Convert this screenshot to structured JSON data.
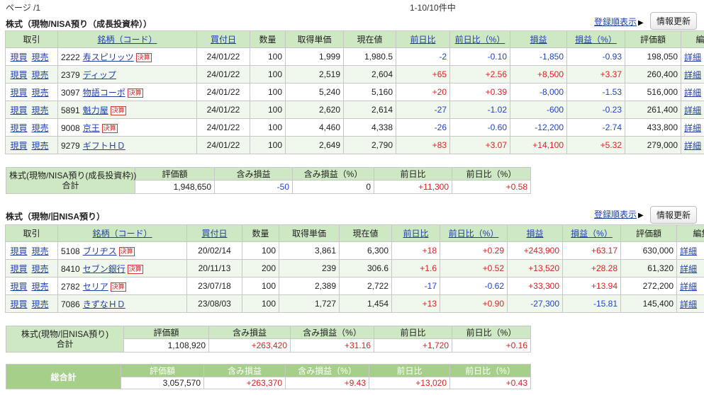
{
  "page_label": "ページ /1",
  "count_label": "1-10/10件中",
  "order_link": "登録順表示",
  "refresh_label": "情報更新",
  "headers": [
    "取引",
    "銘柄（コード）",
    "買付日",
    "数量",
    "取得単価",
    "現在値",
    "前日比",
    "前日比（%）",
    "損益",
    "損益（%）",
    "評価額",
    "編集"
  ],
  "detail_label": "詳細",
  "buy_label": "現買",
  "sell_label": "現売",
  "kessan_label": "決算",
  "sections": [
    {
      "title": "株式（現物/NISA預り（成長投資枠））",
      "rows": [
        {
          "code": "2222",
          "name": "寿スピリッツ",
          "kessan": true,
          "date": "24/01/22",
          "qty": "100",
          "cost": "1,999",
          "price": "1,980.5",
          "chg": "-2",
          "chg_pct": "-0.10",
          "pl": "-1,850",
          "pl_pct": "-0.93",
          "value": "198,050"
        },
        {
          "code": "2379",
          "name": "ディップ",
          "kessan": false,
          "date": "24/01/22",
          "qty": "100",
          "cost": "2,519",
          "price": "2,604",
          "chg": "+65",
          "chg_pct": "+2.56",
          "pl": "+8,500",
          "pl_pct": "+3.37",
          "value": "260,400"
        },
        {
          "code": "3097",
          "name": "物語コーポ",
          "kessan": true,
          "date": "24/01/22",
          "qty": "100",
          "cost": "5,240",
          "price": "5,160",
          "chg": "+20",
          "chg_pct": "+0.39",
          "pl": "-8,000",
          "pl_pct": "-1.53",
          "value": "516,000"
        },
        {
          "code": "5891",
          "name": "魁力屋",
          "kessan": true,
          "date": "24/01/22",
          "qty": "100",
          "cost": "2,620",
          "price": "2,614",
          "chg": "-27",
          "chg_pct": "-1.02",
          "pl": "-600",
          "pl_pct": "-0.23",
          "value": "261,400"
        },
        {
          "code": "9008",
          "name": "京王",
          "kessan": true,
          "date": "24/01/22",
          "qty": "100",
          "cost": "4,460",
          "price": "4,338",
          "chg": "-26",
          "chg_pct": "-0.60",
          "pl": "-12,200",
          "pl_pct": "-2.74",
          "value": "433,800"
        },
        {
          "code": "9279",
          "name": "ギフトＨＤ",
          "kessan": false,
          "date": "24/01/22",
          "qty": "100",
          "cost": "2,649",
          "price": "2,790",
          "chg": "+83",
          "chg_pct": "+3.07",
          "pl": "+14,100",
          "pl_pct": "+5.32",
          "value": "279,000"
        }
      ],
      "summary": {
        "label1": "株式(現物/NISA預り(成長投資枠))",
        "label2": "合計",
        "heads": [
          "評価額",
          "含み損益",
          "含み損益（%）",
          "前日比",
          "前日比（%）"
        ],
        "values": [
          "1,948,650",
          "-50",
          "0",
          "+11,300",
          "+0.58"
        ]
      }
    },
    {
      "title": "株式（現物/旧NISA預り）",
      "rows": [
        {
          "code": "5108",
          "name": "ブリヂス",
          "kessan": true,
          "date": "20/02/14",
          "qty": "100",
          "cost": "3,861",
          "price": "6,300",
          "chg": "+18",
          "chg_pct": "+0.29",
          "pl": "+243,900",
          "pl_pct": "+63.17",
          "value": "630,000"
        },
        {
          "code": "8410",
          "name": "セブン銀行",
          "kessan": true,
          "date": "20/11/13",
          "qty": "200",
          "cost": "239",
          "price": "306.6",
          "chg": "+1.6",
          "chg_pct": "+0.52",
          "pl": "+13,520",
          "pl_pct": "+28.28",
          "value": "61,320"
        },
        {
          "code": "2782",
          "name": "セリア",
          "kessan": true,
          "date": "23/07/18",
          "qty": "100",
          "cost": "2,389",
          "price": "2,722",
          "chg": "-17",
          "chg_pct": "-0.62",
          "pl": "+33,300",
          "pl_pct": "+13.94",
          "value": "272,200"
        },
        {
          "code": "7086",
          "name": "きずなＨＤ",
          "kessan": false,
          "date": "23/08/03",
          "qty": "100",
          "cost": "1,727",
          "price": "1,454",
          "chg": "+13",
          "chg_pct": "+0.90",
          "pl": "-27,300",
          "pl_pct": "-15.81",
          "value": "145,400"
        }
      ],
      "summary": {
        "label1": "株式(現物/旧NISA預り)",
        "label2": "合計",
        "heads": [
          "評価額",
          "含み損益",
          "含み損益（%）",
          "前日比",
          "前日比（%）"
        ],
        "values": [
          "1,108,920",
          "+263,420",
          "+31.16",
          "+1,720",
          "+0.16"
        ]
      }
    }
  ],
  "total": {
    "label": "総合計",
    "heads": [
      "評価額",
      "含み損益",
      "含み損益（%）",
      "前日比",
      "前日比（%）"
    ],
    "values": [
      "3,057,570",
      "+263,370",
      "+9.43",
      "+13,020",
      "+0.43"
    ]
  },
  "colors": {
    "header_bg": "#cfe8c4",
    "alt_row": "#f0f7ec",
    "positive": "#e02020",
    "negative": "#2143c8",
    "link": "#1f3fa8",
    "total_bg": "#9ccb7f"
  }
}
